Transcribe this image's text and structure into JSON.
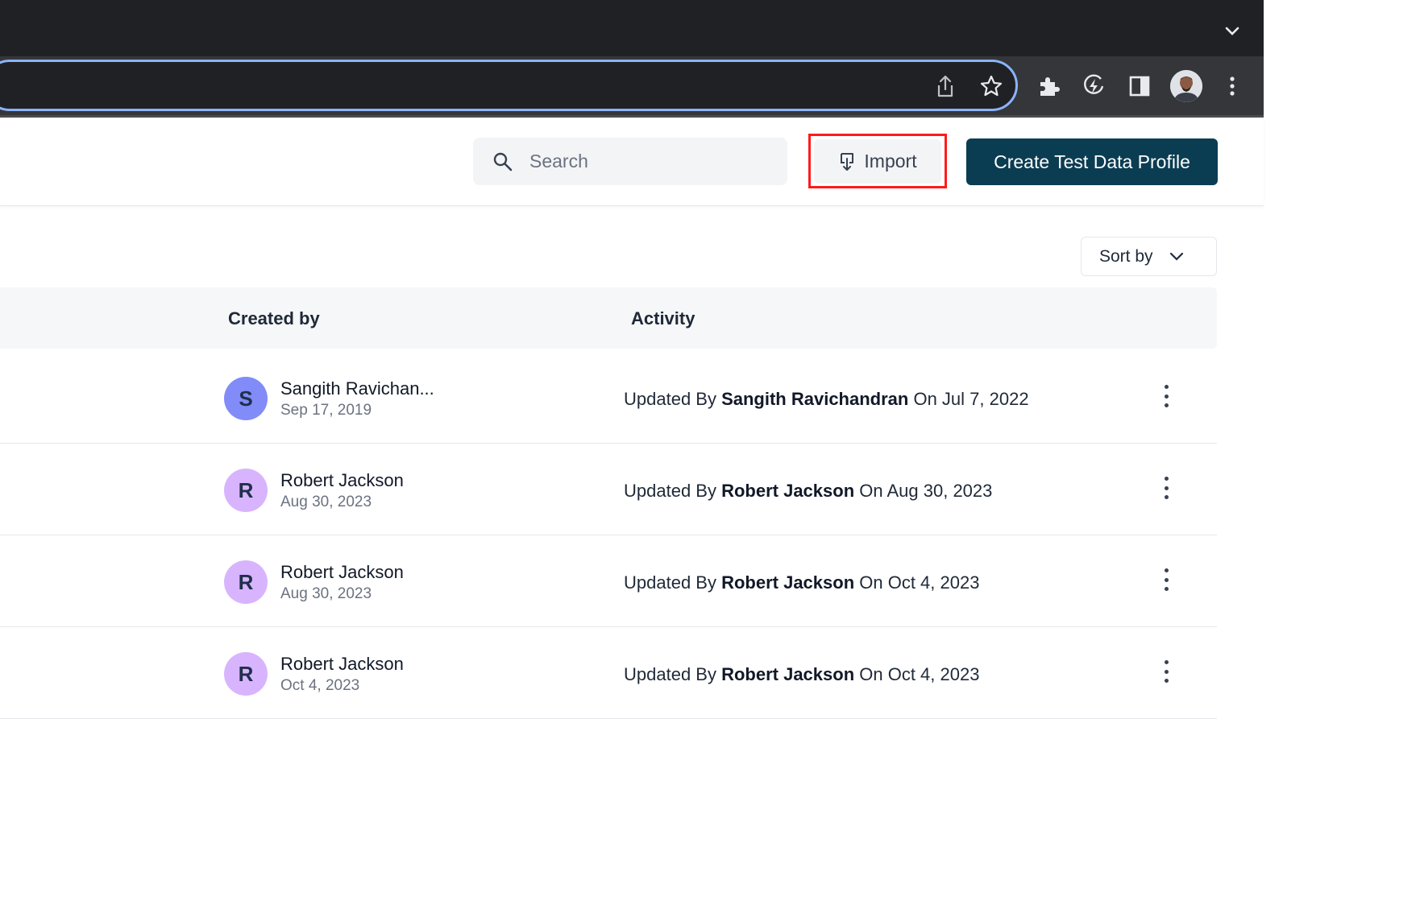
{
  "header": {
    "search_placeholder": "Search",
    "import_label": "Import",
    "create_label": "Create Test Data Profile"
  },
  "sort": {
    "label": "Sort by"
  },
  "table": {
    "columns": [
      "Created by",
      "Activity"
    ],
    "rows": [
      {
        "initial": "S",
        "avatar_color": "#818cf8",
        "creator": "Sangith Ravichan...",
        "created": "Sep 17, 2019",
        "act_prefix": "Updated By ",
        "act_user": "Sangith Ravichandran",
        "act_suffix": " On Jul 7, 2022"
      },
      {
        "initial": "R",
        "avatar_color": "#d8b4fe",
        "creator": "Robert Jackson",
        "created": "Aug 30, 2023",
        "act_prefix": "Updated By ",
        "act_user": "Robert Jackson",
        "act_suffix": " On Aug 30, 2023"
      },
      {
        "initial": "R",
        "avatar_color": "#d8b4fe",
        "creator": "Robert Jackson",
        "created": "Aug 30, 2023",
        "act_prefix": "Updated By ",
        "act_user": "Robert Jackson",
        "act_suffix": " On Oct 4, 2023"
      },
      {
        "initial": "R",
        "avatar_color": "#d8b4fe",
        "creator": "Robert Jackson",
        "created": "Oct 4, 2023",
        "act_prefix": "Updated By ",
        "act_user": "Robert Jackson",
        "act_suffix": " On Oct 4, 2023"
      }
    ]
  },
  "colors": {
    "highlight": "#ff1a1a",
    "primary": "#0b3d52",
    "omnibox_focus": "#8ab4f8"
  },
  "icons": [
    "chevron-down-icon",
    "share-icon",
    "star-icon",
    "extensions-icon",
    "lightning-icon",
    "side-panel-icon",
    "profile-avatar",
    "more-vert-icon",
    "search-icon",
    "import-icon",
    "row-menu-icon"
  ]
}
